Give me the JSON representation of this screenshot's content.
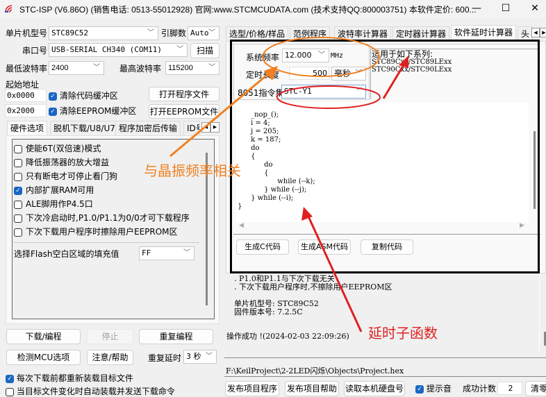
{
  "window": {
    "title": "STC-ISP (V6.86O) (销售电话: 0513-55012928) 官网:www.STCMCUDATA.com  (技术支持QQ:800003751) 本软件定价: 600...",
    "minimize": "—",
    "maximize": "☐",
    "close": "✕"
  },
  "left": {
    "mcu_label": "单片机型号",
    "mcu_value": "STC89C52",
    "pins_label": "引脚数",
    "pins_value": "Auto",
    "port_label": "串口号",
    "port_value": "USB-SERIAL CH340 (COM11)",
    "scan_button": "扫描",
    "min_baud_label": "最低波特率",
    "min_baud_value": "2400",
    "max_baud_label": "最高波特率",
    "max_baud_value": "115200",
    "start_addr_label": "起始地址",
    "addr1": "0x0000",
    "clear_code_label": "清除代码缓冲区",
    "open_program_button": "打开程序文件",
    "addr2": "0x2000",
    "clear_eeprom_label": "清除EEPROM缓冲区",
    "open_eeprom_button": "打开EEPROM文件",
    "tabs": [
      "硬件选项",
      "脱机下载/U8/U7",
      "程序加密后传输",
      "ID号"
    ],
    "options": [
      {
        "label": "使能6T(双倍速)模式",
        "checked": false
      },
      {
        "label": "降低振荡器的放大增益",
        "checked": false
      },
      {
        "label": "只有断电才可停止看门狗",
        "checked": false
      },
      {
        "label": "内部扩展RAM可用",
        "checked": true
      },
      {
        "label": "ALE脚用作P4.5口",
        "checked": false
      },
      {
        "label": "下次冷启动时,P1.0/P1.1为0/0才可下载程序",
        "checked": false
      },
      {
        "label": "下次下载用户程序时擦除用户EEPROM区",
        "checked": false
      }
    ],
    "fill_label": "选择Flash空白区域的填充值",
    "fill_value": "FF",
    "download_button": "下载/编程",
    "stop_button": "停止",
    "reprogram_button": "重复编程",
    "detect_button": "检测MCU选项",
    "help_button": "注意/帮助",
    "repeat_delay_label": "重复延时",
    "repeat_delay_value": "3 秒",
    "reload_label": "每次下载前都重新装载目标文件",
    "reload_checked": true,
    "auto_load_label": "当目标文件变化时自动装载并发送下载命令"
  },
  "right": {
    "tabs": [
      "选型/价格/样品",
      "范例程序",
      "波特率计算器",
      "定时器计算器",
      "软件延时计算器",
      "头"
    ],
    "active_tab": "软件延时计算器",
    "freq_label": "系统频率",
    "freq_value": "12.000",
    "freq_unit": "MHz",
    "duration_label": "定时长度",
    "duration_value": "500",
    "duration_unit": "毫秒",
    "isa_label": "8051指令集",
    "isa_value": "STC-Y1",
    "series_title": "适用于如下系列:",
    "series_1": "STC89Cxx/STC89LExx",
    "series_2": "STC90Cxx/STC90LExx",
    "code_lines": [
      "\t_nop_();",
      "\ti = 4;",
      "\tj = 205;",
      "\tk = 187;",
      "\tdo",
      "\t{",
      "\t\tdo",
      "\t\t{",
      "\t\t\twhile (--k);",
      "\t\t} while (--j);",
      "\t} while (--i);",
      "}"
    ],
    "gen_c_button": "生成C代码",
    "gen_asm_button": "生成ASM代码",
    "copy_button": "复制代码",
    "log_lines": [
      ". P1.0和P1.1与下次下载无关",
      ". 下次下载用户程序时,不擦除用户EEPROM区",
      "",
      "单片机型号: STC89C52",
      "固件版本号: 7.2.5C"
    ],
    "status": "操作成功 !(2024-02-03 22:09:26)",
    "file_path": "F:\\KeilProject\\2-2LED闪烁\\Objects\\Project.hex",
    "publish_program_button": "发布项目程序",
    "publish_help_button": "发布项目帮助",
    "read_disk_button": "读取本机硬盘号",
    "beep_label": "提示音",
    "beep_checked": true,
    "success_count_label": "成功计数",
    "success_count_value": "2",
    "clear_button": "清零"
  },
  "annotations": {
    "crystal_note": "与晶振频率相关",
    "delay_note": "延时子函数"
  },
  "colors": {
    "annotation_orange": "#f08020",
    "annotation_red": "#e02020",
    "checkbox_blue": "#1a66c4"
  }
}
